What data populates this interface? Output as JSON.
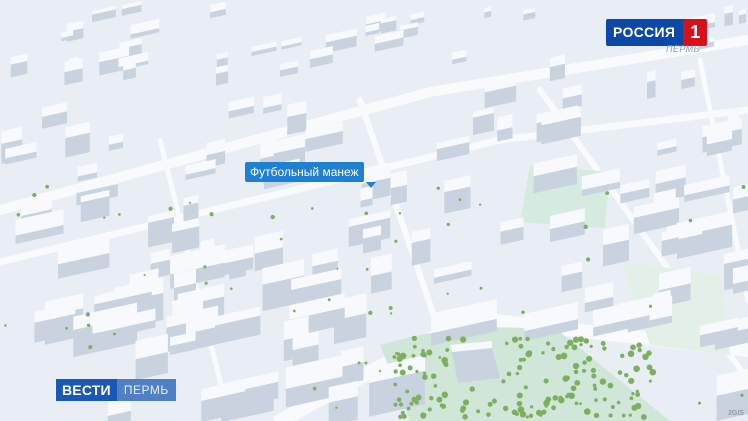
{
  "map": {
    "callout_label": "Футбольный манеж"
  },
  "broadcast": {
    "channel_name": "РОССИЯ",
    "channel_number": "1",
    "channel_region": "ПЕРМЬ",
    "program_name": "ВЕСТИ",
    "program_city": "ПЕРМЬ",
    "corner_text": "2GIS"
  },
  "colors": {
    "background": "#e9eef4",
    "block_top": "#f7f9fc",
    "block_side": "#c9d3df",
    "park": "#cfe6d8",
    "tree": "#7db05e",
    "callout": "#1f7fd0",
    "brand_blue": "#0b48a8",
    "brand_red": "#d4121a"
  }
}
